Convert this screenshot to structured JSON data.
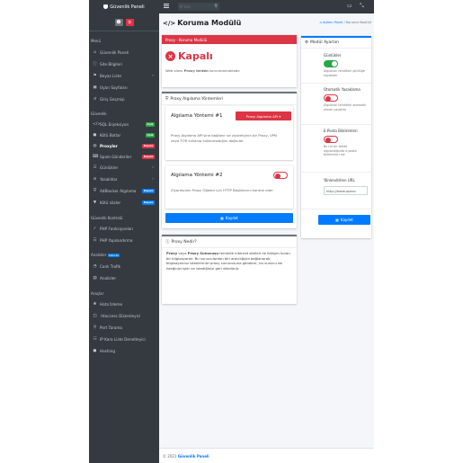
{
  "brand": "Güvenlik Paneli",
  "search": {
    "placeholder": "IP Ara"
  },
  "sidebar": {
    "sections": {
      "menu": "Menü",
      "security": "Güvenlik",
      "security_control": "Güvenlik Kontrolü",
      "analytics": "Analizler",
      "analytics_badge": "Yakında",
      "tools": "Araçlar"
    },
    "items": [
      {
        "label": "Güvenlik Paneli",
        "icon": "home"
      },
      {
        "label": "Site Bilgileri",
        "icon": "info"
      },
      {
        "label": "Beyaz Liste",
        "icon": "flag"
      },
      {
        "label": "Uyarı Sayfaları",
        "icon": "file"
      },
      {
        "label": "Giriş Geçmişi",
        "icon": "history"
      },
      {
        "label": "SQL Enjeksiyon",
        "icon": "code",
        "badge": "Açık",
        "badge_color": "#28a745"
      },
      {
        "label": "Kötü Botlar",
        "icon": "robot",
        "badge": "Açık",
        "badge_color": "#28a745"
      },
      {
        "label": "Proxyler",
        "icon": "globe",
        "badge": "Kapalı",
        "badge_color": "#dc3545"
      },
      {
        "label": "Spam Gönderiler",
        "icon": "keyboard",
        "badge": "Kapalı",
        "badge_color": "#dc3545"
      },
      {
        "label": "Günlükler",
        "icon": "list"
      },
      {
        "label": "Yasaklılar",
        "icon": "ban"
      },
      {
        "label": "AdBlocker Algılama",
        "icon": "shield",
        "badge": "Kapalı",
        "badge_color": "#007bff"
      },
      {
        "label": "Kötü sözler",
        "icon": "filter",
        "badge": "Kapalı",
        "badge_color": "#007bff"
      },
      {
        "label": "PHP Fonksiyonları",
        "icon": "check"
      },
      {
        "label": "PHP Yapılandırma",
        "icon": "bars"
      },
      {
        "label": "Canlı Trafik",
        "icon": "gauge"
      },
      {
        "label": "Analizler",
        "icon": "chart"
      },
      {
        "label": "Hata İzleme",
        "icon": "bug"
      },
      {
        "label": ".htaccess Düzenleyici",
        "icon": "columns"
      },
      {
        "label": "Port Tarama",
        "icon": "search"
      },
      {
        "label": "IP Kara Liste Denetleyici",
        "icon": "list-alt"
      },
      {
        "label": "Hashing",
        "icon": "lock"
      }
    ]
  },
  "page": {
    "title": "Koruma Modülü",
    "breadcrumb_home": "Admin Panel",
    "breadcrumb_sep": "/",
    "breadcrumb_current": "Koruma Modülü"
  },
  "status_card": {
    "header": "Proxy - Koruma Modülü",
    "status": "Kapalı",
    "desc_prefix": "Web sitesi",
    "desc_bold": "Proxy lerden",
    "desc_suffix": "korunmamaktadır"
  },
  "detection_card": {
    "header": "Proxy Algılama Yöntemleri",
    "method1_title": "Algılama Yöntemi #1",
    "method1_button": "Proxy Algılama API",
    "method1_desc": "Proxy Algılama API'sine bağlanır ve ziyaretçinin bir Proxy, VPN veya TOR kullanıp kullanmadığını doğrular",
    "method2_title": "Algılama Yöntemi #2",
    "method2_desc": "Ziyaretçinin Proxy Öğeleri için HTTP Başlıklarını kontrol eder",
    "save": "Kaydet"
  },
  "info_card": {
    "header": "Proxy Nedir?",
    "p1": "Proxy",
    "p2": " veya ",
    "p3": "Proxy Sunucusu",
    "p4": " temelde internet siteleri ile iletişim kuran bir bilgisayardır. Bu sunuculardan biri aracılığıyla bağlanarak; bilgisayarınız isteklerinizi proxy sunucusuna gönderir, bu sunucu da isteğinizi işler ve istediğinizi geri döndürür.",
    "full": "Proxy veya Proxy Sunucusu temelde internet siteleriyle iletişimi yapan bir aracı gibi davranan bir bilgisayardır. Bu sunuculardan biri aracılığıyla bağlanarak; bilgisayarınız isteklerinizi proxy sunucusuna gönderir, bu sunucu da isteğinizi işler ve istediğinizi geri döndürür."
  },
  "settings": {
    "header": "Modül Ayarları",
    "logs_label": "Günlükler",
    "logs_desc": "Algılanan tehditleri günlüğe kaydeder",
    "autoban_label": "Otomatik Yasaklama",
    "autoban_desc": "Algılanan tehditleri otomatik olarak yasaklar",
    "email_label": "E-Posta Bildirimleri",
    "email_desc": "Bu tür bir tehdit algılandığında e-posta bildirimleri alır",
    "redirect_label": "Yönlendirilen URL",
    "redirect_value": "http://www.openc",
    "save": "Kaydet"
  },
  "footer": {
    "prefix": "© 2021",
    "brand": "Güvenlik Paneli"
  }
}
